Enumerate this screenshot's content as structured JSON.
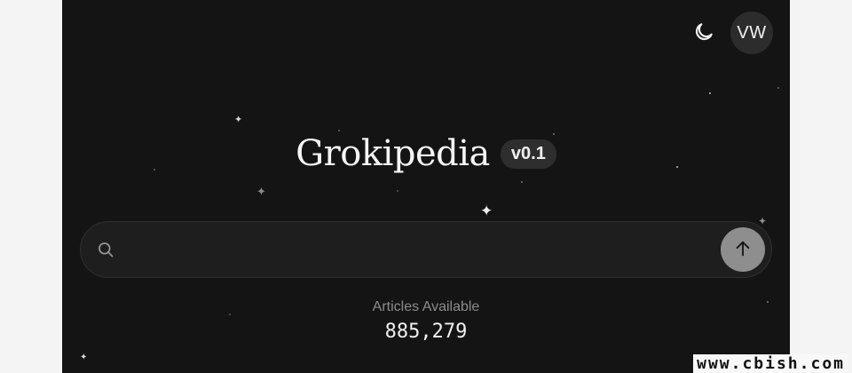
{
  "header": {
    "theme_toggle_icon": "moon-icon",
    "avatar_initials": "VW"
  },
  "hero": {
    "title": "Grokipedia",
    "version": "v0.1"
  },
  "search": {
    "icon": "search-icon",
    "placeholder": "",
    "value": "",
    "submit_icon": "arrow-up-icon"
  },
  "stats": {
    "label": "Articles Available",
    "value": "885,279"
  },
  "watermark": {
    "text": "www.cbish.com"
  },
  "colors": {
    "background": "#141414",
    "search_bg": "#1e1e1e",
    "submit_bg": "#8e8e8e",
    "badge_bg": "#2e2e2e"
  }
}
